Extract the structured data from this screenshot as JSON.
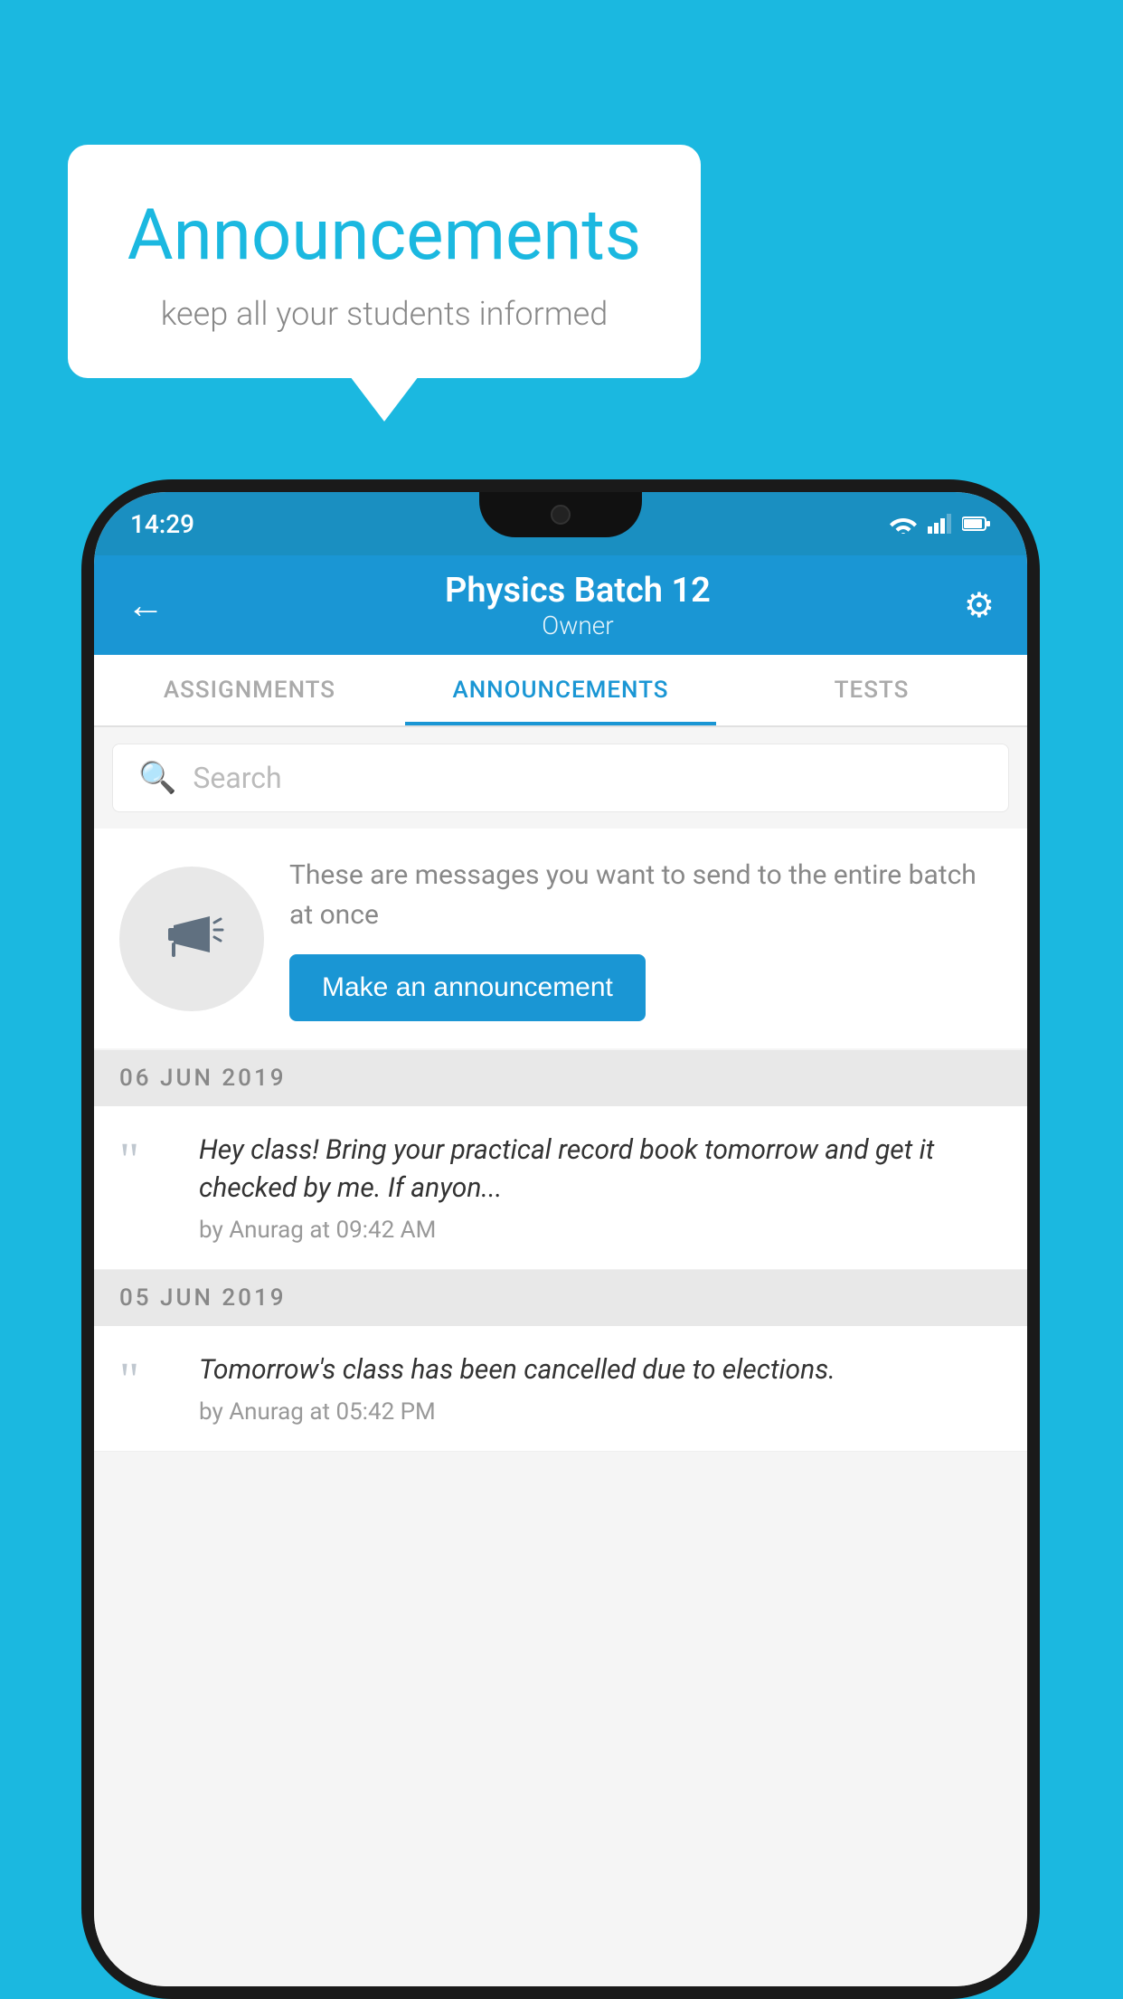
{
  "background_color": "#1BB8E0",
  "speech_bubble": {
    "title": "Announcements",
    "subtitle": "keep all your students informed"
  },
  "phone": {
    "status_bar": {
      "time": "14:29"
    },
    "app_bar": {
      "title": "Physics Batch 12",
      "subtitle": "Owner",
      "back_label": "←"
    },
    "tabs": [
      {
        "label": "ASSIGNMENTS",
        "active": false
      },
      {
        "label": "ANNOUNCEMENTS",
        "active": true
      },
      {
        "label": "TESTS",
        "active": false
      }
    ],
    "search": {
      "placeholder": "Search"
    },
    "cta": {
      "description": "These are messages you want to send to the entire batch at once",
      "button_label": "Make an announcement"
    },
    "announcements": [
      {
        "date": "06  JUN  2019",
        "text": "Hey class! Bring your practical record book tomorrow and get it checked by me. If anyon...",
        "meta": "by Anurag at 09:42 AM"
      },
      {
        "date": "05  JUN  2019",
        "text": "Tomorrow's class has been cancelled due to elections.",
        "meta": "by Anurag at 05:42 PM"
      }
    ]
  }
}
